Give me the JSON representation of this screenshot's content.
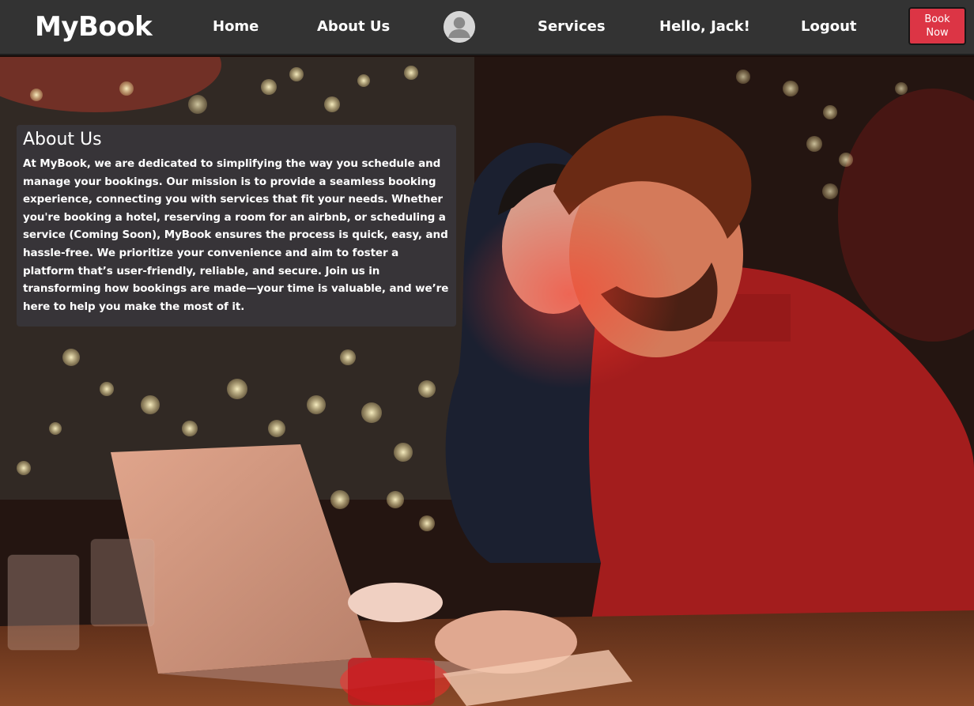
{
  "header": {
    "brand": "MyBook",
    "nav": {
      "home": "Home",
      "about": "About Us",
      "services": "Services",
      "greeting": "Hello, Jack!",
      "logout": "Logout"
    },
    "avatar_icon": "user-avatar-icon",
    "book_button": {
      "line1": "Book",
      "line2": "Now"
    },
    "colors": {
      "navbar_bg": "#333333",
      "book_button_bg": "#dc3545",
      "text": "#ffffff"
    }
  },
  "about": {
    "title": "About Us",
    "body": "At MyBook, we are dedicated to simplifying the way you schedule and manage your bookings. Our mission is to provide a seamless booking experience, connecting you with services that fit your needs. Whether you're booking a hotel, reserving a room for an airbnb, or scheduling a service (Coming Soon), MyBook ensures the process is quick, easy, and hassle-free. We prioritize your convenience and aim to foster a platform that’s user-friendly, reliable, and secure. Join us in transforming how bookings are made—your time is valuable, and we’re here to help you make the most of it."
  },
  "hero_image": {
    "subject": "couple-using-laptop-photo"
  }
}
